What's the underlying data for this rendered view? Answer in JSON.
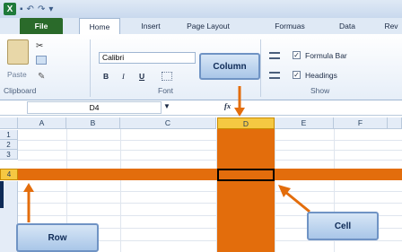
{
  "titlebar": {
    "app_icon": "X",
    "quick_access": [
      "save-icon",
      "undo-icon",
      "redo-icon",
      "customize-icon"
    ]
  },
  "tabs": {
    "file": "File",
    "home": "Home",
    "insert": "Insert",
    "page_layout": "Page Layout",
    "formulas": "Formuas",
    "data": "Data",
    "review": "Rev"
  },
  "ribbon": {
    "clipboard": {
      "label": "Clipboard",
      "paste": "Paste"
    },
    "font": {
      "label": "Font",
      "name": "Calibri",
      "bold": "B",
      "italic": "I",
      "underline": "U"
    },
    "show": {
      "label": "Show",
      "formula_bar": "Formula Bar",
      "headings": "Headings",
      "check": "✓"
    }
  },
  "formula_bar": {
    "name_box": "D4",
    "fx": "fx"
  },
  "grid": {
    "columns": [
      "A",
      "B",
      "C",
      "D",
      "E",
      "F"
    ],
    "rows": [
      "1",
      "2",
      "3",
      "4"
    ]
  },
  "callouts": {
    "column": "Column",
    "cell": "Cell",
    "row": "Row"
  },
  "colors": {
    "highlight": "#e36d0c",
    "callout_border": "#6f93c4",
    "callout_fill": "#c0d7f0"
  }
}
